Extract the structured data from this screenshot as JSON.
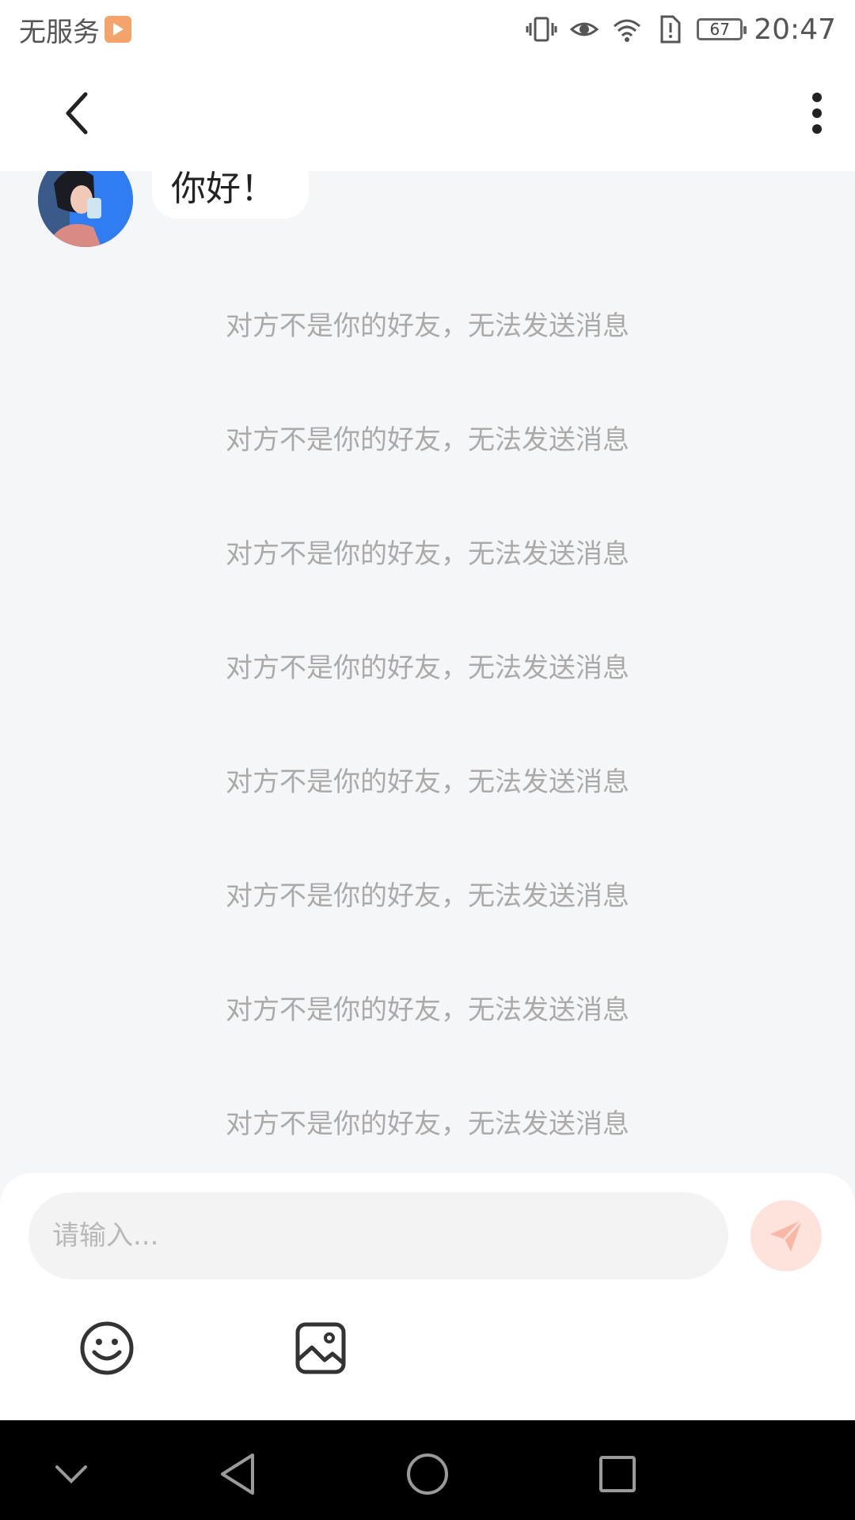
{
  "status_bar": {
    "carrier": "无服务",
    "battery_level": "67",
    "time": "20:47"
  },
  "chat": {
    "messages": [
      {
        "sender": "other",
        "text": "你好！"
      }
    ],
    "system_notices": [
      "对方不是你的好友，无法发送消息",
      "对方不是你的好友，无法发送消息",
      "对方不是你的好友，无法发送消息",
      "对方不是你的好友，无法发送消息",
      "对方不是你的好友，无法发送消息",
      "对方不是你的好友，无法发送消息",
      "对方不是你的好友，无法发送消息",
      "对方不是你的好友，无法发送消息"
    ]
  },
  "composer": {
    "placeholder": "请输入...",
    "value": ""
  },
  "icons": {
    "back": "chevron-left-icon",
    "more": "more-vertical-icon",
    "send": "send-icon",
    "emoji": "emoji-icon",
    "image": "image-icon"
  },
  "colors": {
    "background": "#f5f6f8",
    "notice_text": "#aaaaaa",
    "send_button": "#fde3dc",
    "send_icon": "#f9b7a6"
  }
}
